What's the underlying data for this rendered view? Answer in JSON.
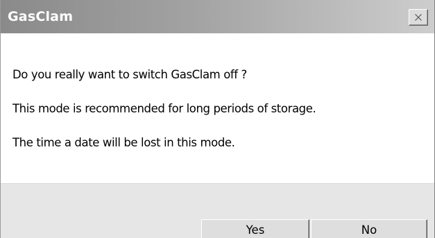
{
  "window": {
    "title": "GasClam",
    "close_icon": "close-icon"
  },
  "message": {
    "lines": [
      "Do you really want to switch GasClam off ?",
      "This mode is recommended for long periods of storage.",
      "The time a date will be lost in this mode."
    ]
  },
  "buttons": {
    "yes_label": "Yes",
    "no_label": "No"
  },
  "colors": {
    "title_text": "#ffffff",
    "title_gradient_start": "#8a8a8a",
    "title_gradient_end": "#cdcdcd",
    "footer_background": "#e6e6e6",
    "button_face": "#dedede"
  }
}
